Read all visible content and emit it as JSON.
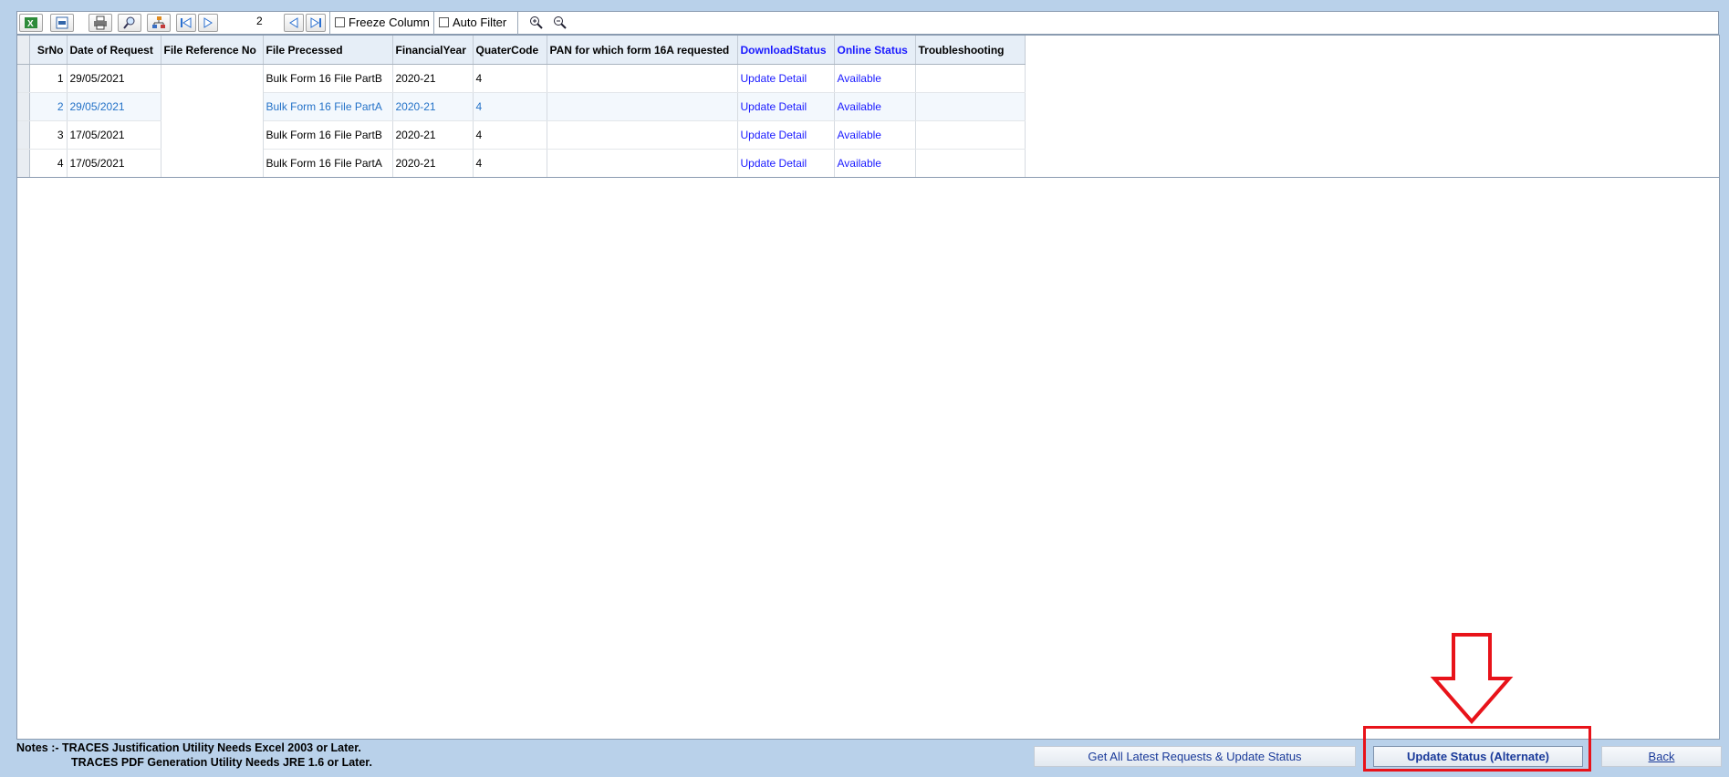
{
  "toolbar": {
    "page_number": "2",
    "freeze_column_label": "Freeze Column",
    "auto_filter_label": "Auto Filter",
    "icons": [
      "excel-export-icon",
      "csv-export-icon",
      "print-icon",
      "preview-icon",
      "hierarchy-icon",
      "first-page-icon",
      "next-page-icon",
      "prev-page-icon",
      "last-page-icon",
      "zoom-in-icon",
      "zoom-out-icon"
    ]
  },
  "table": {
    "headers": {
      "srno": "SrNo",
      "date": "Date of Request",
      "fileref": "File Reference No",
      "processed": "File Precessed",
      "fy": "FinancialYear",
      "quarter": "QuaterCode",
      "pan": "PAN for which form 16A requested",
      "download": "DownloadStatus",
      "online": "Online Status",
      "troubleshooting": "Troubleshooting"
    },
    "rows": [
      {
        "srno": "1",
        "date": "29/05/2021",
        "fileref": "",
        "processed": "Bulk Form 16 File PartB",
        "fy": "2020-21",
        "quarter": "4",
        "pan": "",
        "download": "Update Detail",
        "online": "Available",
        "troubleshooting": ""
      },
      {
        "srno": "2",
        "date": "29/05/2021",
        "fileref": "",
        "processed": "Bulk Form 16 File PartA",
        "fy": "2020-21",
        "quarter": "4",
        "pan": "",
        "download": "Update Detail",
        "online": "Available",
        "troubleshooting": ""
      },
      {
        "srno": "3",
        "date": "17/05/2021",
        "fileref": "",
        "processed": "Bulk Form 16 File PartB",
        "fy": "2020-21",
        "quarter": "4",
        "pan": "",
        "download": "Update Detail",
        "online": "Available",
        "troubleshooting": ""
      },
      {
        "srno": "4",
        "date": "17/05/2021",
        "fileref": "",
        "processed": "Bulk Form 16 File PartA",
        "fy": "2020-21",
        "quarter": "4",
        "pan": "",
        "download": "Update Detail",
        "online": "Available",
        "troubleshooting": ""
      }
    ]
  },
  "notes": {
    "line1": "Notes :- TRACES Justification Utility Needs Excel 2003 or Later.",
    "line2": "TRACES PDF Generation Utility Needs JRE 1.6 or Later."
  },
  "buttons": {
    "get_latest": "Get All Latest Requests & Update Status",
    "update_alternate": "Update Status (Alternate)",
    "back": "Back"
  },
  "colors": {
    "window_bg": "#b9d1ea",
    "link_blue": "#1a1aff",
    "highlight_red": "#e8131a"
  }
}
